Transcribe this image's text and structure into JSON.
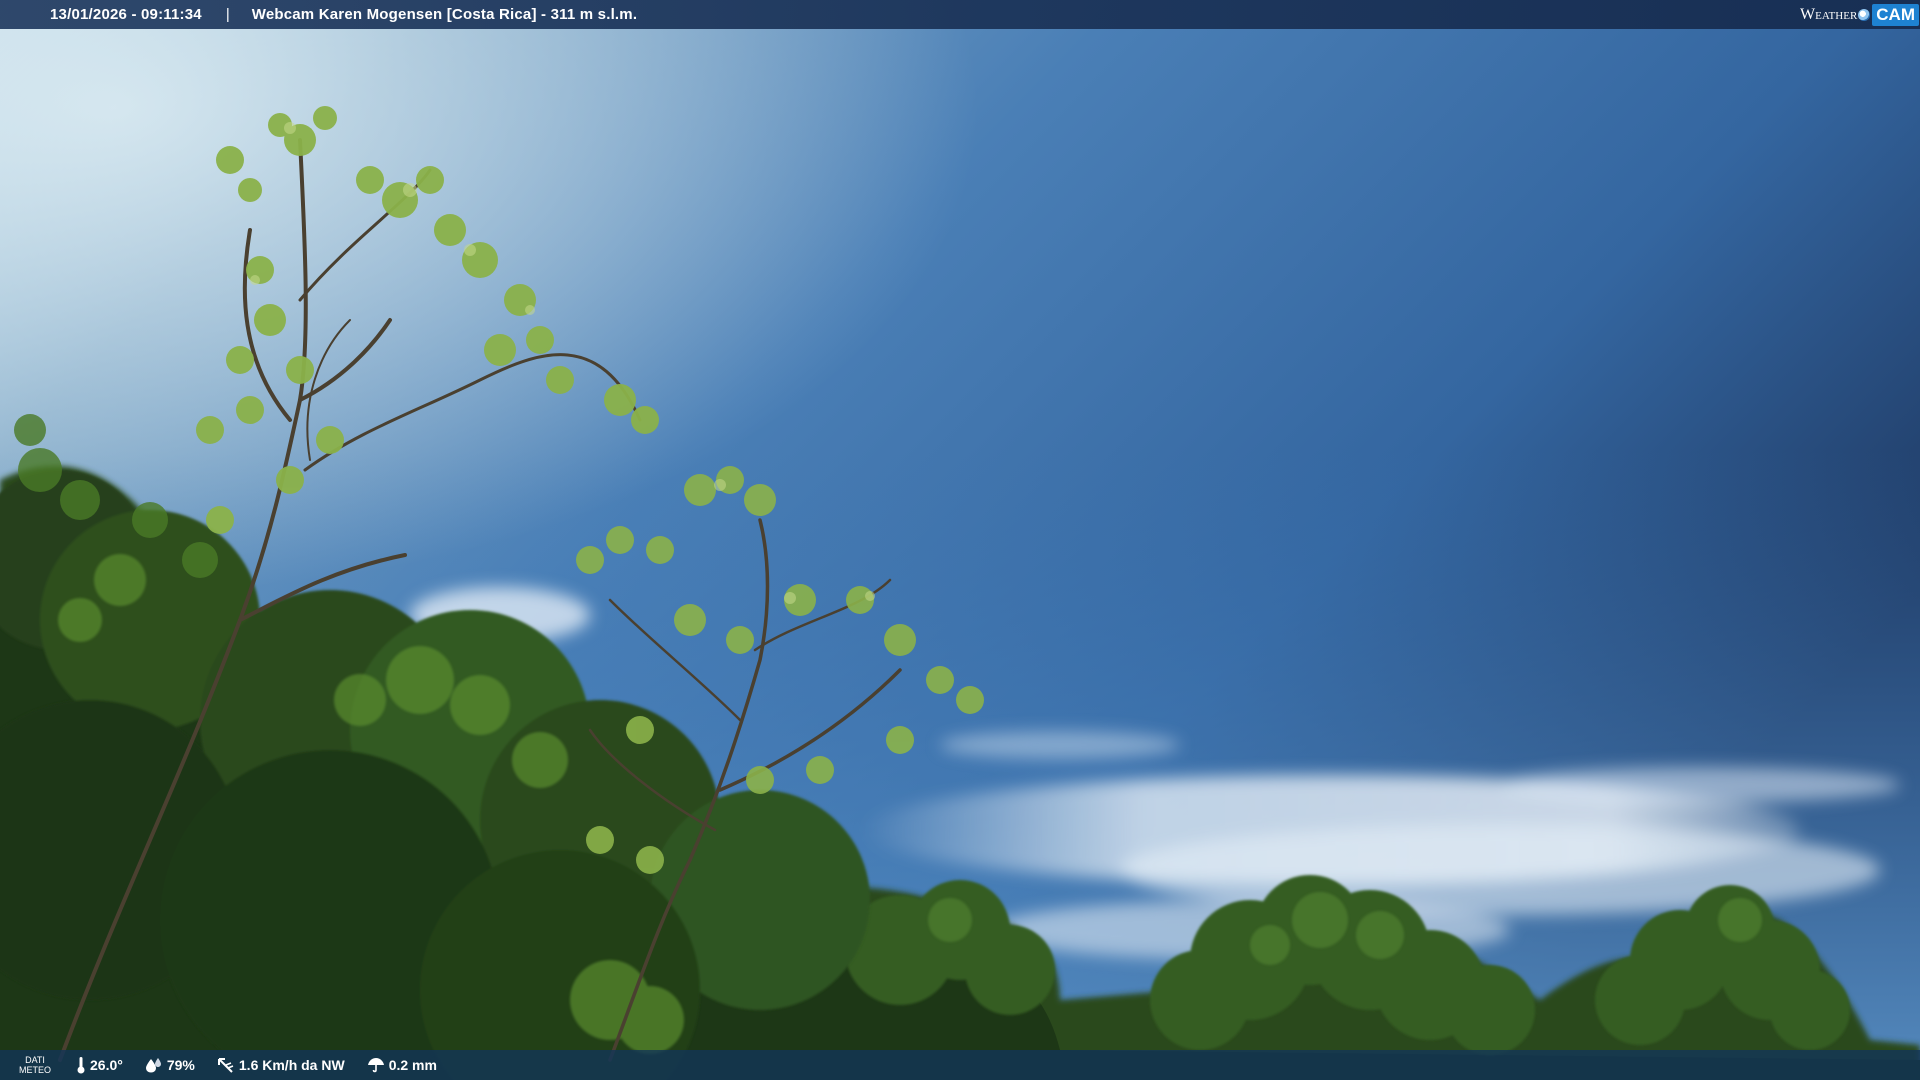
{
  "overlay": {
    "timestamp": "13/01/2026 - 09:11:34",
    "separator": "|",
    "location": "Webcam Karen Mogensen [Costa Rica]  - 311 m s.l.m."
  },
  "brand": {
    "word1": "Weather",
    "word2": "CAM"
  },
  "weather": {
    "label_line1": "DATI",
    "label_line2": "METEO",
    "temperature": "26.0°",
    "humidity": "79%",
    "wind": "1.6 Km/h da NW",
    "rain": "0.2 mm"
  },
  "colors": {
    "sky_top_right": "#1f3a64",
    "sky_mid": "#3f77b4",
    "sky_bright_left": "#b5d2e3",
    "foliage_dark": "#1c3516",
    "foliage_mid": "#3d6a22",
    "foliage_light": "#7aa53a",
    "overlay_bar": "#1c3a66",
    "brand_blue": "#1e82d2"
  }
}
